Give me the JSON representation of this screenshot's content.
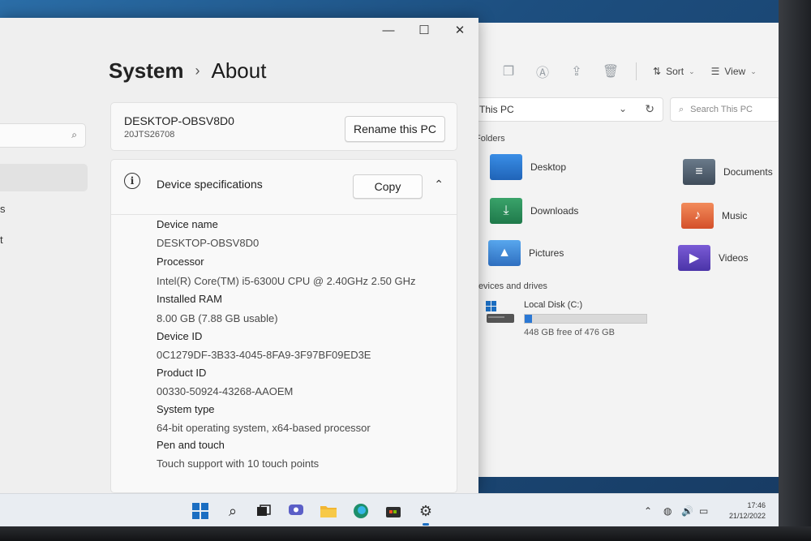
{
  "explorer": {
    "toolbar": {
      "sort_label": "Sort",
      "view_label": "View"
    },
    "address": "This PC",
    "search_placeholder": "Search This PC",
    "sections": {
      "folders": "Folders",
      "drives": "Devices and drives"
    },
    "folders": [
      {
        "name": "Desktop",
        "icon": "desktop-folder-icon"
      },
      {
        "name": "Documents",
        "icon": "documents-folder-icon"
      },
      {
        "name": "Downloads",
        "icon": "downloads-folder-icon"
      },
      {
        "name": "Music",
        "icon": "music-folder-icon"
      },
      {
        "name": "Pictures",
        "icon": "pictures-folder-icon"
      },
      {
        "name": "Videos",
        "icon": "videos-folder-icon"
      }
    ],
    "drive": {
      "name": "Local Disk (C:)",
      "free_text": "448 GB free of 476 GB",
      "used_fraction": 0.06
    }
  },
  "settings": {
    "breadcrumb": {
      "parent": "System",
      "current": "About"
    },
    "pc": {
      "name": "DESKTOP-OBSV8D0",
      "model": "20JTS26708",
      "rename_label": "Rename this PC"
    },
    "specs": {
      "title": "Device specifications",
      "copy_label": "Copy",
      "rows": [
        {
          "label": "Device name",
          "value": "DESKTOP-OBSV8D0"
        },
        {
          "label": "Processor",
          "value": "Intel(R) Core(TM) i5-6300U CPU @ 2.40GHz   2.50 GHz"
        },
        {
          "label": "Installed RAM",
          "value": "8.00 GB (7.88 GB usable)"
        },
        {
          "label": "Device ID",
          "value": "0C1279DF-3B33-4045-8FA9-3F97BF09ED3E"
        },
        {
          "label": "Product ID",
          "value": "00330-50924-43268-AAOEM"
        },
        {
          "label": "System type",
          "value": "64-bit operating system, x64-based processor"
        },
        {
          "label": "Pen and touch",
          "value": "Touch support with 10 touch points"
        }
      ]
    },
    "left_fragments": [
      "s",
      "t"
    ]
  },
  "taskbar": {
    "time": "17:46",
    "date": "21/12/2022"
  },
  "colors": {
    "accent": "#2b78d4",
    "folder_blue": "#2064b8"
  }
}
